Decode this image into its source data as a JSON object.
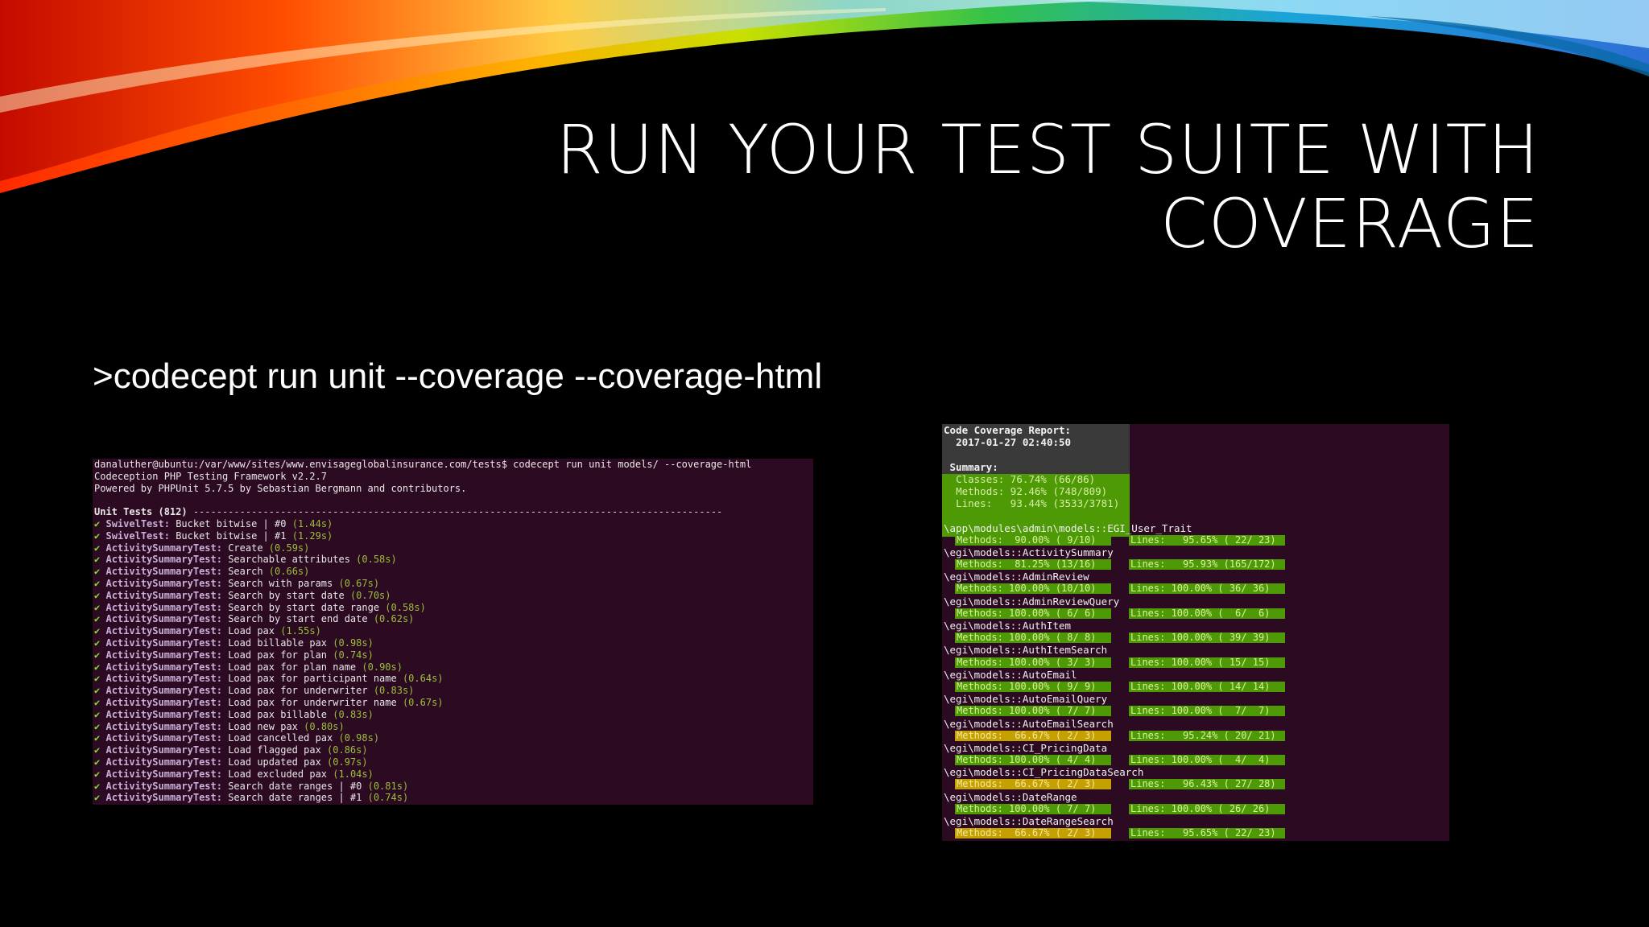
{
  "slide": {
    "title_line1": "RUN YOUR TEST SUITE WITH",
    "title_line2": "COVERAGE",
    "command": ">codecept run unit --coverage --coverage-html"
  },
  "colors": {
    "terminal_bg": "#2c0a22",
    "pass_green": "#8ae234",
    "coverage_green": "#4e9a06",
    "coverage_orange": "#c4a000"
  },
  "left_terminal": {
    "prompt": "danaluther@ubuntu:/var/www/sites/www.envisageglobalinsurance.com/tests$ codecept run unit models/ --coverage-html",
    "banner1": "Codeception PHP Testing Framework v2.2.7",
    "banner2": "Powered by PHPUnit 5.7.5 by Sebastian Bergmann and contributors.",
    "section": "Unit Tests (812)",
    "section_dashes": "-------------------------------------------------------------------------------------------",
    "tick": "✔",
    "tests": [
      {
        "name": "SwivelTest:",
        "desc": "Bucket bitwise | #0",
        "time": "(1.44s)"
      },
      {
        "name": "SwivelTest:",
        "desc": "Bucket bitwise | #1",
        "time": "(1.29s)"
      },
      {
        "name": "ActivitySummaryTest:",
        "desc": "Create",
        "time": "(0.59s)"
      },
      {
        "name": "ActivitySummaryTest:",
        "desc": "Searchable attributes",
        "time": "(0.58s)"
      },
      {
        "name": "ActivitySummaryTest:",
        "desc": "Search",
        "time": "(0.66s)"
      },
      {
        "name": "ActivitySummaryTest:",
        "desc": "Search with params",
        "time": "(0.67s)"
      },
      {
        "name": "ActivitySummaryTest:",
        "desc": "Search by start date",
        "time": "(0.70s)"
      },
      {
        "name": "ActivitySummaryTest:",
        "desc": "Search by start date range",
        "time": "(0.58s)"
      },
      {
        "name": "ActivitySummaryTest:",
        "desc": "Search by start end date",
        "time": "(0.62s)"
      },
      {
        "name": "ActivitySummaryTest:",
        "desc": "Load pax",
        "time": "(1.55s)"
      },
      {
        "name": "ActivitySummaryTest:",
        "desc": "Load billable pax",
        "time": "(0.98s)"
      },
      {
        "name": "ActivitySummaryTest:",
        "desc": "Load pax for plan",
        "time": "(0.74s)"
      },
      {
        "name": "ActivitySummaryTest:",
        "desc": "Load pax for plan name",
        "time": "(0.90s)"
      },
      {
        "name": "ActivitySummaryTest:",
        "desc": "Load pax for participant name",
        "time": "(0.64s)"
      },
      {
        "name": "ActivitySummaryTest:",
        "desc": "Load pax for underwriter",
        "time": "(0.83s)"
      },
      {
        "name": "ActivitySummaryTest:",
        "desc": "Load pax for underwriter name",
        "time": "(0.67s)"
      },
      {
        "name": "ActivitySummaryTest:",
        "desc": "Load pax billable",
        "time": "(0.83s)"
      },
      {
        "name": "ActivitySummaryTest:",
        "desc": "Load new pax",
        "time": "(0.80s)"
      },
      {
        "name": "ActivitySummaryTest:",
        "desc": "Load cancelled pax",
        "time": "(0.98s)"
      },
      {
        "name": "ActivitySummaryTest:",
        "desc": "Load flagged pax",
        "time": "(0.86s)"
      },
      {
        "name": "ActivitySummaryTest:",
        "desc": "Load updated pax",
        "time": "(0.97s)"
      },
      {
        "name": "ActivitySummaryTest:",
        "desc": "Load excluded pax",
        "time": "(1.04s)"
      },
      {
        "name": "ActivitySummaryTest:",
        "desc": "Search date ranges | #0",
        "time": "(0.81s)"
      },
      {
        "name": "ActivitySummaryTest:",
        "desc": "Search date ranges | #1",
        "time": "(0.74s)"
      }
    ]
  },
  "right_terminal": {
    "report_title": "Code Coverage Report:",
    "report_date": "2017-01-27 02:40:50",
    "summary_label": "Summary:",
    "summary": [
      "Classes: 76.74% (66/86)",
      "Methods: 92.46% (748/809)",
      "Lines:   93.44% (3533/3781)"
    ],
    "classes": [
      {
        "name": "\\app\\modules\\admin\\models::EGI_User_Trait",
        "methods": "Methods:  90.00% ( 9/10)",
        "lines": "Lines:   95.65% ( 22/ 23)",
        "mcolor": "green"
      },
      {
        "name": "\\egi\\models::ActivitySummary",
        "methods": "Methods:  81.25% (13/16)",
        "lines": "Lines:   95.93% (165/172)",
        "mcolor": "green"
      },
      {
        "name": "\\egi\\models::AdminReview",
        "methods": "Methods: 100.00% (10/10)",
        "lines": "Lines: 100.00% ( 36/ 36)",
        "mcolor": "green"
      },
      {
        "name": "\\egi\\models::AdminReviewQuery",
        "methods": "Methods: 100.00% ( 6/ 6)",
        "lines": "Lines: 100.00% (  6/  6)",
        "mcolor": "green"
      },
      {
        "name": "\\egi\\models::AuthItem",
        "methods": "Methods: 100.00% ( 8/ 8)",
        "lines": "Lines: 100.00% ( 39/ 39)",
        "mcolor": "green"
      },
      {
        "name": "\\egi\\models::AuthItemSearch",
        "methods": "Methods: 100.00% ( 3/ 3)",
        "lines": "Lines: 100.00% ( 15/ 15)",
        "mcolor": "green"
      },
      {
        "name": "\\egi\\models::AutoEmail",
        "methods": "Methods: 100.00% ( 9/ 9)",
        "lines": "Lines: 100.00% ( 14/ 14)",
        "mcolor": "green"
      },
      {
        "name": "\\egi\\models::AutoEmailQuery",
        "methods": "Methods: 100.00% ( 7/ 7)",
        "lines": "Lines: 100.00% (  7/  7)",
        "mcolor": "green"
      },
      {
        "name": "\\egi\\models::AutoEmailSearch",
        "methods": "Methods:  66.67% ( 2/ 3)",
        "lines": "Lines:   95.24% ( 20/ 21)",
        "mcolor": "orange"
      },
      {
        "name": "\\egi\\models::CI_PricingData",
        "methods": "Methods: 100.00% ( 4/ 4)",
        "lines": "Lines: 100.00% (  4/  4)",
        "mcolor": "green"
      },
      {
        "name": "\\egi\\models::CI_PricingDataSearch",
        "methods": "Methods:  66.67% ( 2/ 3)",
        "lines": "Lines:   96.43% ( 27/ 28)",
        "mcolor": "orange"
      },
      {
        "name": "\\egi\\models::DateRange",
        "methods": "Methods: 100.00% ( 7/ 7)",
        "lines": "Lines: 100.00% ( 26/ 26)",
        "mcolor": "green"
      },
      {
        "name": "\\egi\\models::DateRangeSearch",
        "methods": "Methods:  66.67% ( 2/ 3)",
        "lines": "Lines:   95.65% ( 22/ 23)",
        "mcolor": "orange"
      }
    ]
  }
}
